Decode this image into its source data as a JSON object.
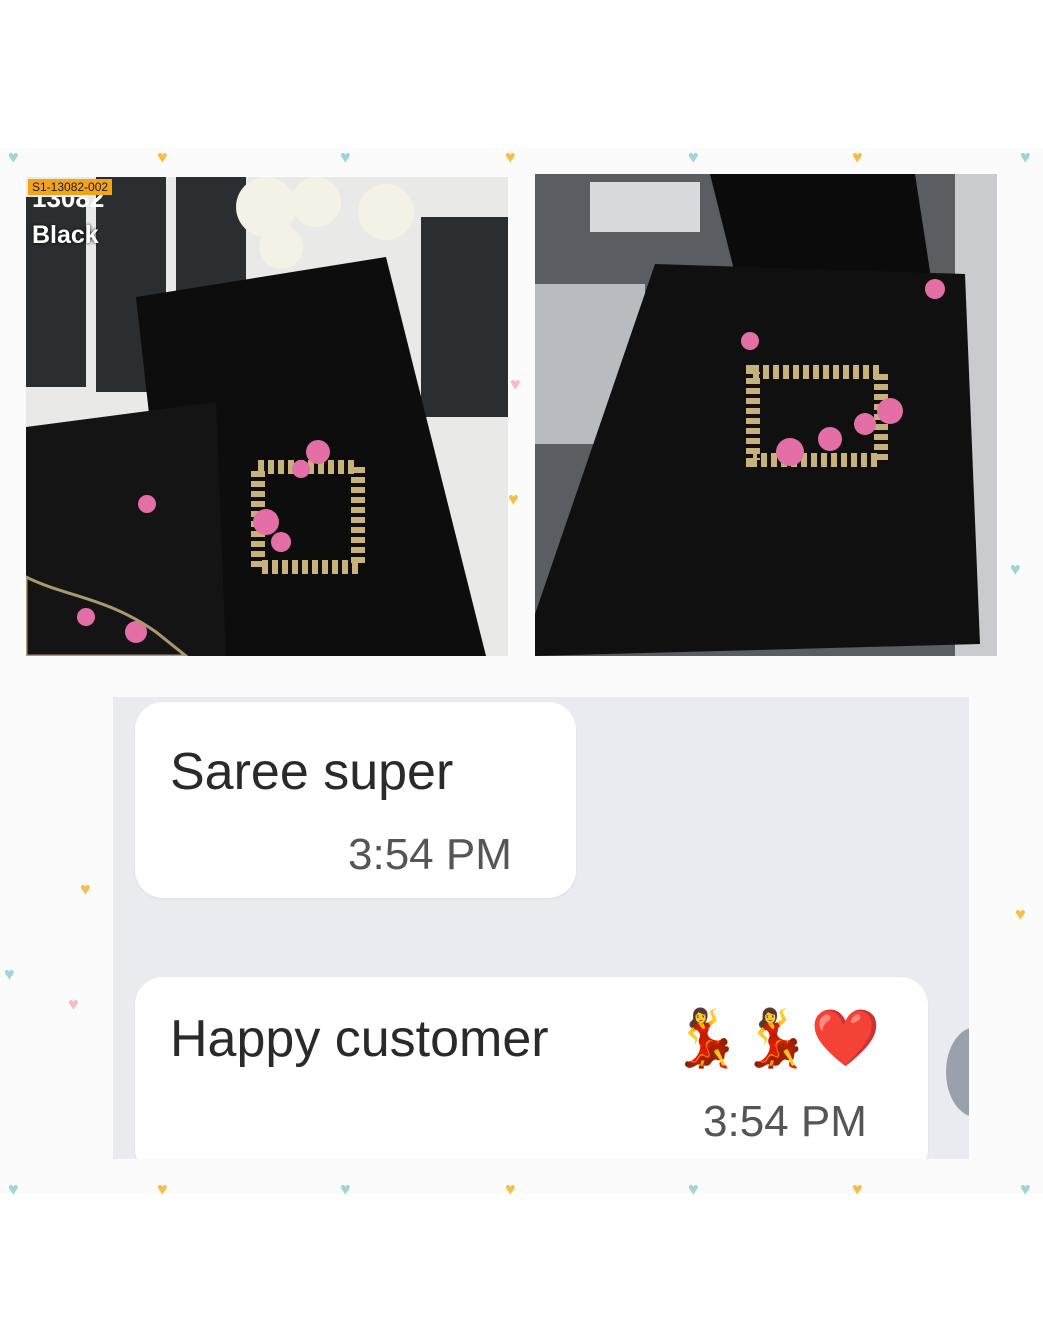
{
  "photos": {
    "left": {
      "sku_tag": "S1-13082-002",
      "code": "13082",
      "color": "Black"
    }
  },
  "chat": {
    "messages": [
      {
        "text": "Saree super",
        "time": "3:54 PM",
        "emoji": ""
      },
      {
        "text": "Happy customer",
        "time": "3:54 PM",
        "emoji": "💃💃❤️"
      }
    ]
  },
  "colors": {
    "accent_orange": "#f4a41c",
    "chat_background": "#e9ebf1",
    "bubble": "#ffffff"
  }
}
